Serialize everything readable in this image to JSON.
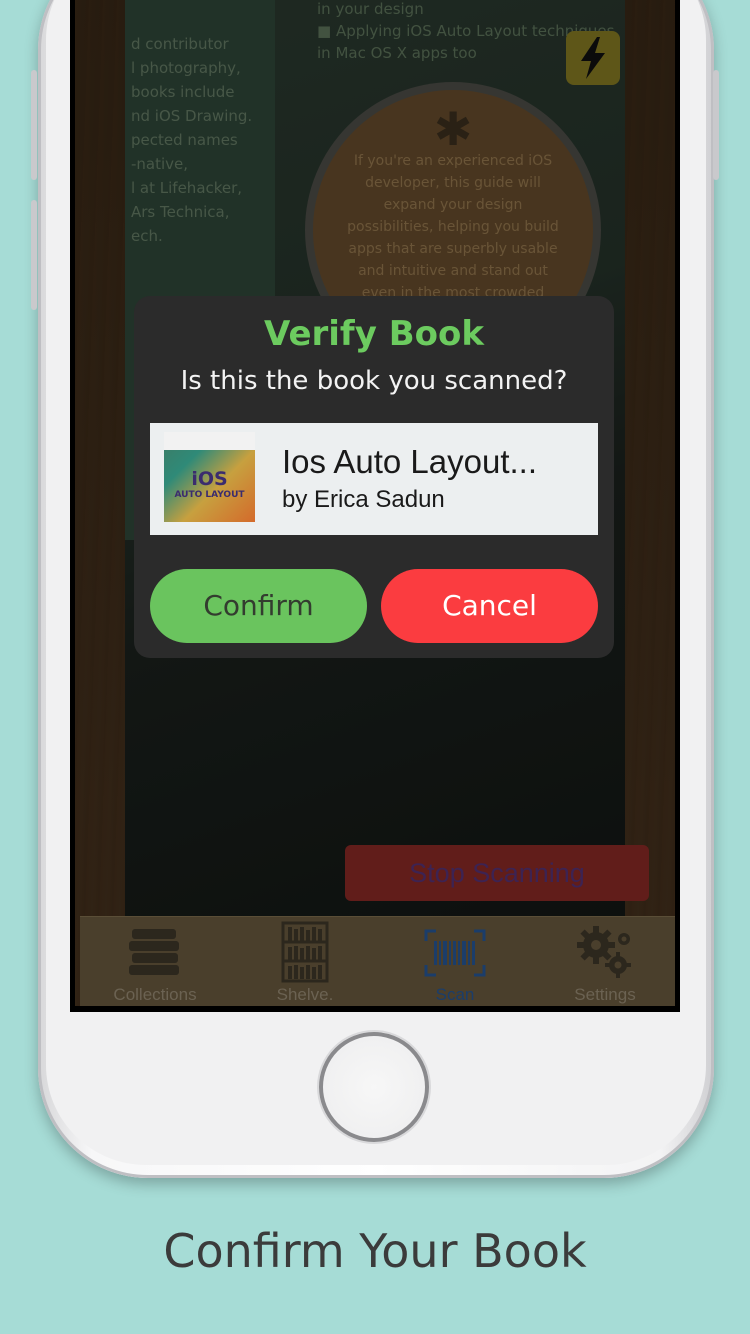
{
  "colors": {
    "background": "#a6dcd6",
    "title_green": "#6ccb5f",
    "confirm_green": "#6ac45e",
    "cancel_red": "#fb3c40",
    "scan_active": "#1b3d6a"
  },
  "background_book": {
    "left_text": "d contributor\nl photography,\nbooks include\nnd iOS Drawing.\npected names\n-native,\nl at Lifehacker,\nArs Technica,\nech.",
    "right_text": "in your design\n■  Applying iOS Auto Layout techniques\n    in Mac OS X apps too",
    "circle_text": "If you're an experienced iOS developer, this guide will expand your design possibilities, helping you build apps that are superbly usable and intuitive and stand out even in the most crowded marketplace."
  },
  "flash_icon": "lightning-bolt-icon",
  "stop_button": {
    "label": "Stop Scanning"
  },
  "dialog": {
    "title": "Verify Book",
    "subtitle": "Is this the book you scanned?",
    "book": {
      "title": "Ios Auto Layout...",
      "author": "by Erica Sadun",
      "cover_title": "iOS",
      "cover_subtitle": "AUTO LAYOUT"
    },
    "confirm_label": "Confirm",
    "cancel_label": "Cancel"
  },
  "tabbar": {
    "items": [
      {
        "label": "Collections",
        "icon": "books-stack-icon",
        "active": false
      },
      {
        "label": "Shelve.",
        "icon": "bookshelf-icon",
        "active": false
      },
      {
        "label": "Scan",
        "icon": "barcode-scan-icon",
        "active": true
      },
      {
        "label": "Settings",
        "icon": "gears-icon",
        "active": false
      }
    ]
  },
  "caption": "Confirm Your Book"
}
